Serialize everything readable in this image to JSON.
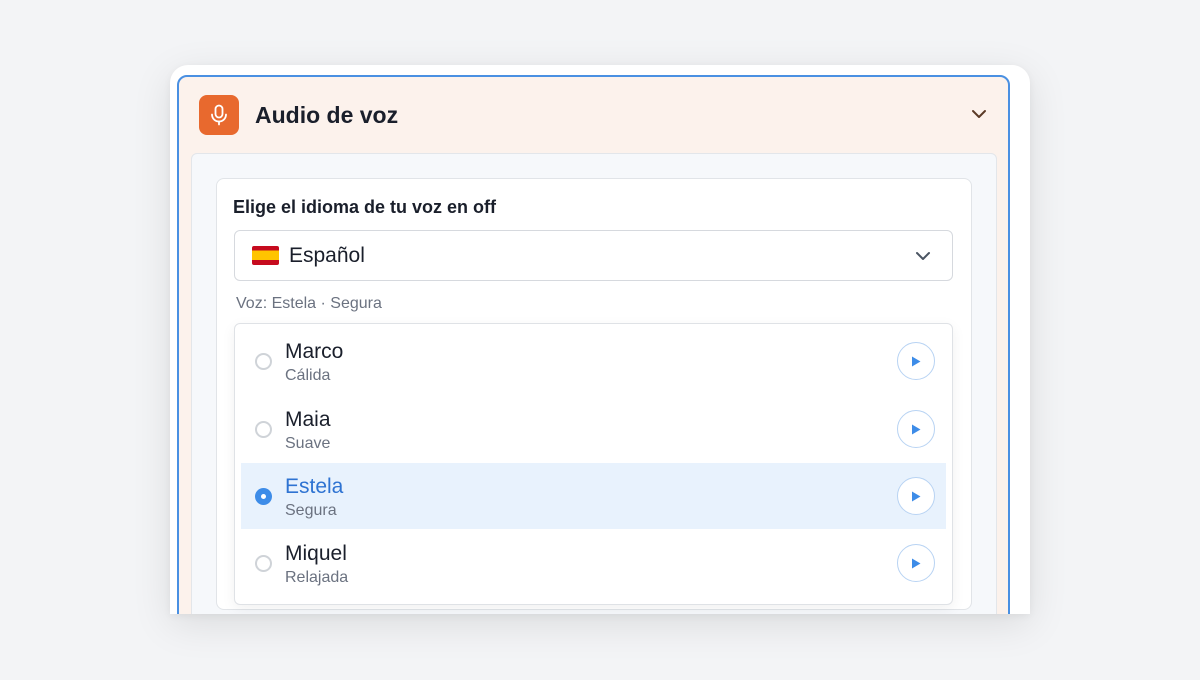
{
  "panel": {
    "title": "Audio de voz",
    "icon": "microphone-icon",
    "accent_color": "#e8692e",
    "collapse_icon": "chevron-down-icon"
  },
  "language": {
    "label": "Elige el idioma de tu voz en off",
    "selected": "Español",
    "flag": "spain-flag-icon"
  },
  "voice_summary": "Voz: Estela · Segura",
  "voices": [
    {
      "name": "Marco",
      "description": "Cálida",
      "selected": false
    },
    {
      "name": "Maia",
      "description": "Suave",
      "selected": false
    },
    {
      "name": "Estela",
      "description": "Segura",
      "selected": true
    },
    {
      "name": "Miquel",
      "description": "Relajada",
      "selected": false
    }
  ]
}
